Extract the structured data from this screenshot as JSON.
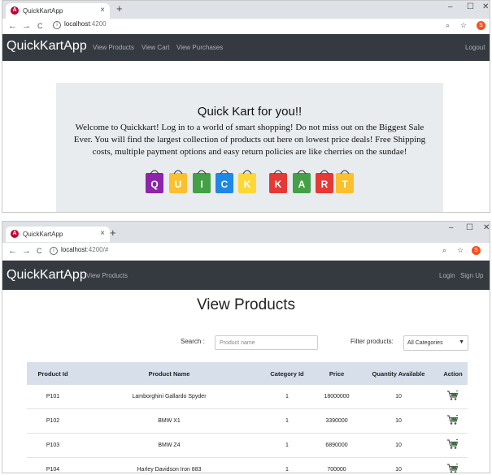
{
  "browser": {
    "tab_title": "QuickKartApp",
    "tab_close": "×",
    "new_tab": "+",
    "win_min": "–",
    "win_max": "☐",
    "win_close": "✕",
    "back": "←",
    "forward": "→",
    "reload": "C",
    "profile_initial": "S"
  },
  "screen1": {
    "url_host": "localhost",
    "url_path": ":4200",
    "brand": "QuickKartApp",
    "nav": [
      "View Products",
      "View Cart",
      "View Purchases"
    ],
    "logout": "Logout",
    "heading": "Quick Kart for you!!",
    "intro": "Welcome to Quickkart! Log in to a world of smart shopping! Do not miss out on the Biggest Sale Ever. You will find the largest collection of products out here on lowest price deals! Free Shipping costs, multiple payment options and easy return policies are like cherries on the sundae!",
    "logo_letters": [
      "Q",
      "U",
      "I",
      "C",
      "K",
      "K",
      "A",
      "R",
      "T"
    ]
  },
  "screen2": {
    "url_host": "localhost",
    "url_path": ":4200/#",
    "brand": "QuickKartApp",
    "nav": [
      "View Products"
    ],
    "login": "Login",
    "signup": "Sign Up",
    "title": "View Products",
    "search_label": "Search :",
    "search_placeholder": "Product name",
    "filter_label": "Filter products:",
    "filter_value": "All Categories",
    "table": {
      "headers": [
        "Product Id",
        "Product Name",
        "Category Id",
        "Price",
        "Quantity Available",
        "Action"
      ],
      "rows": [
        [
          "P101",
          "Lamborghini Gallardo Spyder",
          "1",
          "18000000",
          "10"
        ],
        [
          "P102",
          "BMW X1",
          "1",
          "3390000",
          "10"
        ],
        [
          "P103",
          "BMW Z4",
          "1",
          "6890000",
          "10"
        ],
        [
          "P104",
          "Harley Davidson Iron 883",
          "1",
          "700000",
          "10"
        ]
      ]
    }
  },
  "colors": {
    "navbar": "#343a40",
    "jumbotron": "#e9ecef",
    "table_header": "#d6dfea",
    "cart_icon": "#2e7d32"
  }
}
